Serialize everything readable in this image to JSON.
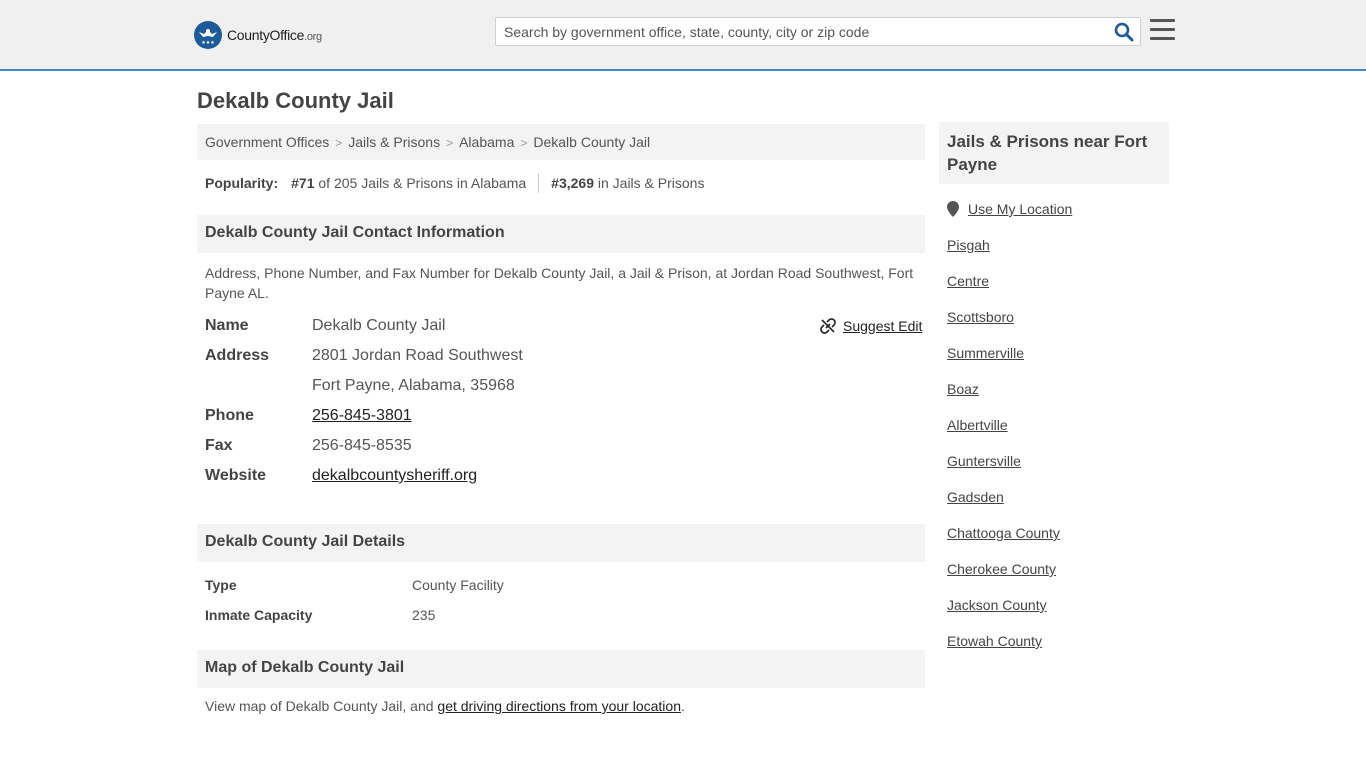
{
  "header": {
    "logo_text_main": "CountyOffice",
    "logo_text_suffix": ".org",
    "search_placeholder": "Search by government office, state, county, city or zip code"
  },
  "page": {
    "title": "Dekalb County Jail"
  },
  "breadcrumb": [
    "Government Offices",
    "Jails & Prisons",
    "Alabama",
    "Dekalb County Jail"
  ],
  "popularity": {
    "label": "Popularity:",
    "state_rank": "#71",
    "state_text": "of 205 Jails & Prisons in Alabama",
    "national_rank": "#3,269",
    "national_text": "in Jails & Prisons"
  },
  "contact": {
    "heading": "Dekalb County Jail Contact Information",
    "description": "Address, Phone Number, and Fax Number for Dekalb County Jail, a Jail & Prison, at Jordan Road Southwest, Fort Payne AL.",
    "suggest_edit": "Suggest Edit",
    "name_label": "Name",
    "name": "Dekalb County Jail",
    "address_label": "Address",
    "address_line1": "2801 Jordan Road Southwest",
    "address_line2": "Fort Payne, Alabama, 35968",
    "phone_label": "Phone",
    "phone": "256-845-3801",
    "fax_label": "Fax",
    "fax": "256-845-8535",
    "website_label": "Website",
    "website": "dekalbcountysheriff.org"
  },
  "details": {
    "heading": "Dekalb County Jail Details",
    "type_label": "Type",
    "type": "County Facility",
    "capacity_label": "Inmate Capacity",
    "capacity": "235"
  },
  "map": {
    "heading": "Map of Dekalb County Jail",
    "text": "View map of Dekalb County Jail, and ",
    "link": "get driving directions from your location",
    "end": "."
  },
  "sidebar": {
    "heading": "Jails & Prisons near Fort Payne",
    "use_location": "Use My Location",
    "items": [
      "Pisgah",
      "Centre",
      "Scottsboro",
      "Summerville",
      "Boaz",
      "Albertville",
      "Guntersville",
      "Gadsden",
      "Chattooga County",
      "Cherokee County",
      "Jackson County",
      "Etowah County"
    ]
  },
  "colors": {
    "brand_blue": "#1c5a9a",
    "header_border": "#4a86c5",
    "search_icon": "#1c5a9a"
  }
}
